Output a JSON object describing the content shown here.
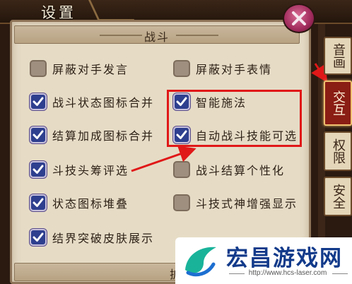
{
  "window": {
    "title": "设置"
  },
  "sections": [
    {
      "label": "战斗"
    },
    {
      "label": "扩展向"
    }
  ],
  "options": [
    {
      "label": "屏蔽对手发言",
      "checked": false
    },
    {
      "label": "屏蔽对手表情",
      "checked": false
    },
    {
      "label": "战斗状态图标合并",
      "checked": true
    },
    {
      "label": "智能施法",
      "checked": true
    },
    {
      "label": "结算加成图标合并",
      "checked": true
    },
    {
      "label": "自动战斗技能可选",
      "checked": true
    },
    {
      "label": "斗技头筹评选",
      "checked": true
    },
    {
      "label": "战斗结算个性化",
      "checked": false
    },
    {
      "label": "状态图标堆叠",
      "checked": true
    },
    {
      "label": "斗技式神增强显示",
      "checked": false
    },
    {
      "label": "结界突破皮肤展示",
      "checked": true
    }
  ],
  "side_tabs": [
    {
      "label": "音画",
      "active": false
    },
    {
      "label": "交互",
      "active": true
    },
    {
      "label": "权限",
      "active": false
    },
    {
      "label": "安全",
      "active": false
    }
  ],
  "colors": {
    "highlight": "#e01818",
    "checkbox_on": "#2e3f8f",
    "active_tab": "#8a1d14"
  },
  "icons": {
    "close": "close-x-icon",
    "check": "checkmark-icon"
  },
  "watermark": {
    "name": "宏昌游戏网",
    "url": "http://www.hcs-laser.com"
  }
}
